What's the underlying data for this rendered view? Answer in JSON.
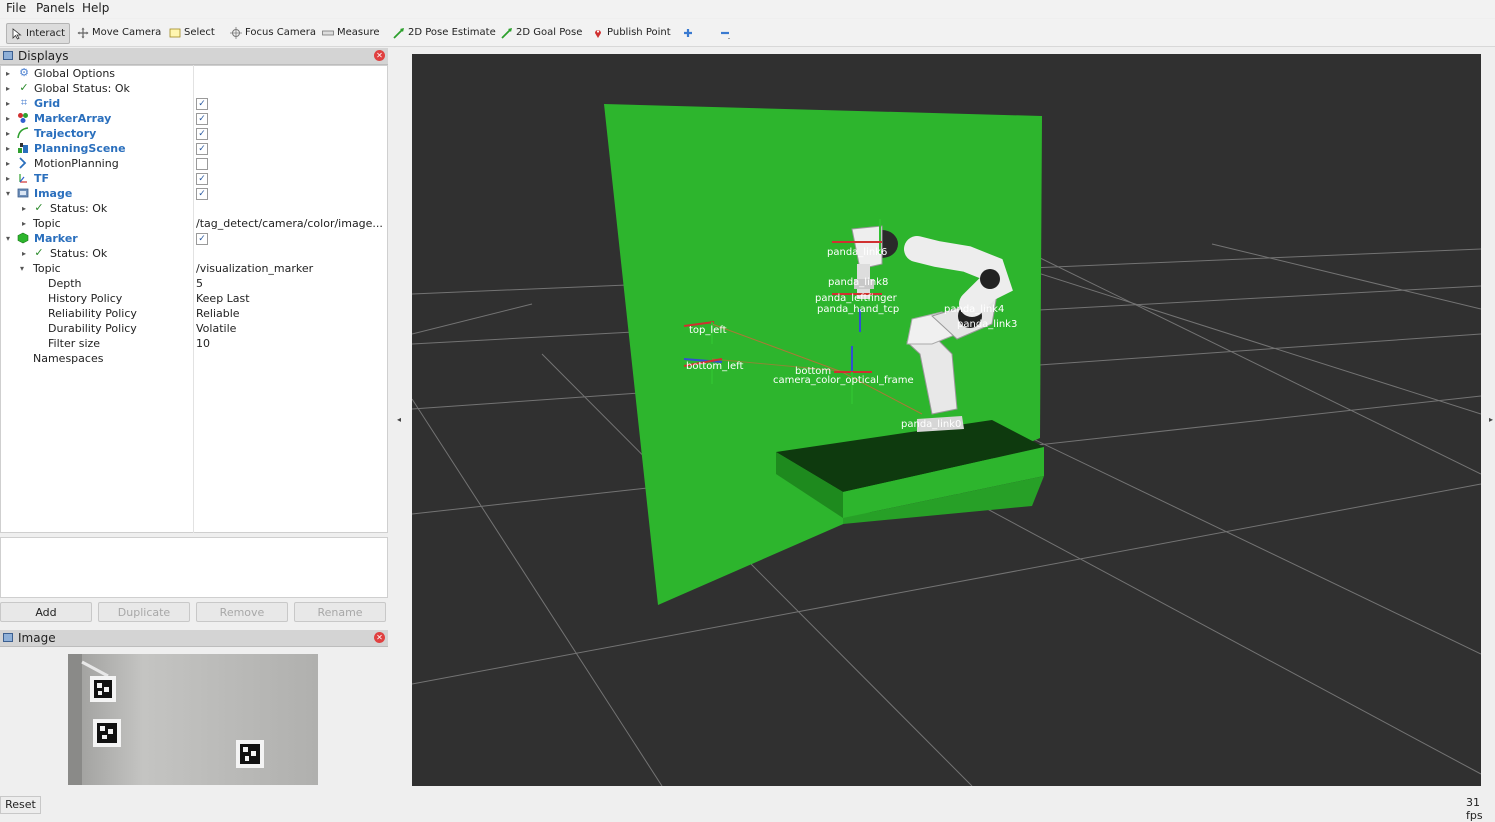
{
  "menu": {
    "file": "File",
    "panels": "Panels",
    "help": "Help"
  },
  "toolbar": {
    "interact": "Interact",
    "move_camera": "Move Camera",
    "select": "Select",
    "focus_camera": "Focus Camera",
    "measure": "Measure",
    "pose_estimate": "2D Pose Estimate",
    "goal_pose": "2D Goal Pose",
    "publish_point": "Publish Point"
  },
  "displays_panel": {
    "title": "Displays",
    "rows": [
      {
        "label": "Global Options"
      },
      {
        "label": "Global Status: Ok"
      },
      {
        "label": "Grid",
        "checked": true
      },
      {
        "label": "MarkerArray",
        "checked": true
      },
      {
        "label": "Trajectory",
        "checked": true
      },
      {
        "label": "PlanningScene",
        "checked": true
      },
      {
        "label": "MotionPlanning",
        "checked": false
      },
      {
        "label": "TF",
        "checked": true
      },
      {
        "label": "Image",
        "checked": true
      },
      {
        "label": "Status: Ok"
      },
      {
        "label": "Topic",
        "value": "/tag_detect/camera/color/image..."
      },
      {
        "label": "Marker",
        "checked": true
      },
      {
        "label": "Status: Ok"
      },
      {
        "label": "Topic",
        "value": "/visualization_marker"
      },
      {
        "label": "Depth",
        "value": "5"
      },
      {
        "label": "History Policy",
        "value": "Keep Last"
      },
      {
        "label": "Reliability Policy",
        "value": "Reliable"
      },
      {
        "label": "Durability Policy",
        "value": "Volatile"
      },
      {
        "label": "Filter size",
        "value": "10"
      },
      {
        "label": "Namespaces"
      }
    ],
    "buttons": {
      "add": "Add",
      "duplicate": "Duplicate",
      "remove": "Remove",
      "rename": "Rename"
    }
  },
  "image_panel": {
    "title": "Image"
  },
  "scene_labels": {
    "top_left": "top_left",
    "bottom_left": "bottom_left",
    "panda_link6": "panda_link6",
    "panda_link8": "panda_link8",
    "panda_finger": "panda_leftfinger",
    "panda_hand_tcp": "panda_hand_tcp",
    "panda_link4": "panda_link4",
    "panda_link3": "panda_link3",
    "bottom": "bottom",
    "camera_frames": "camera_color_optical_frame",
    "panda_link0": "panda_link0"
  },
  "status": {
    "reset": "Reset",
    "fps": "31 fps"
  },
  "colors": {
    "accent": "#2a6fbd",
    "wall": "#2db52d",
    "viewport": "#303030"
  }
}
